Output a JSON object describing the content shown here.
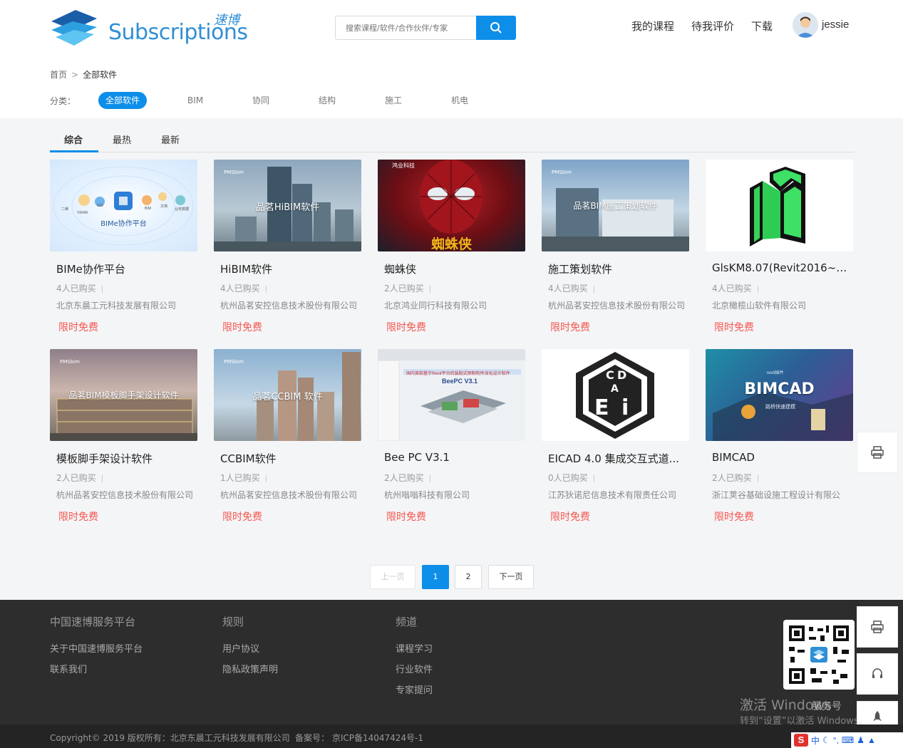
{
  "header": {
    "logo_text": "Subscriptions",
    "logo_cn": "速博",
    "search_placeholder": "搜索课程/软件/合作伙伴/专家",
    "nav": [
      "我的课程",
      "待我评价",
      "下载"
    ],
    "username": "jessie"
  },
  "breadcrumb": {
    "home": "首页",
    "sep": ">",
    "current": "全部软件"
  },
  "categories": {
    "label": "分类：",
    "items": [
      "全部软件",
      "BIM",
      "协同",
      "结构",
      "施工",
      "机电"
    ],
    "active_index": 0
  },
  "tabs": {
    "items": [
      "综合",
      "最热",
      "最新"
    ],
    "active_index": 0
  },
  "thumb_labels": {
    "pms": "PMSbim",
    "bime": "BIMe协作平台",
    "hibim": "品茗HiBIM软件",
    "spider": "蜘蛛侠",
    "spider_logo": "鸿业科技",
    "construction": "品茗BIM施工策划软件",
    "scaffold": "品茗BIM模板脚手架设计软件",
    "ccbim": "品茗CCBIM 软件",
    "beepc": "BeePC V3.1",
    "beepc_banner": "国内首款基于Revit平台的装配式预制构件深化设计软件",
    "bimcad": "BIMCAD",
    "bimcad_sub": "路桥快速建模",
    "bimcad_top": "revit插件",
    "bime_nodes": [
      "二维",
      "VR/AR",
      "GIS",
      "BIM",
      "文档",
      "业务数据"
    ]
  },
  "cards": [
    {
      "title": "BIMe协作平台",
      "buyers": "4人已购买",
      "company": "北京东晨工元科技发展有限公司",
      "price": "限时免费"
    },
    {
      "title": "HiBIM软件",
      "buyers": "4人已购买",
      "company": "杭州品茗安控信息技术股份有限公司",
      "price": "限时免费"
    },
    {
      "title": "蜘蛛侠",
      "buyers": "2人已购买",
      "company": "北京鸿业同行科技有限公司",
      "price": "限时免费"
    },
    {
      "title": "施工策划软件",
      "buyers": "4人已购买",
      "company": "杭州品茗安控信息技术股份有限公司",
      "price": "限时免费"
    },
    {
      "title": "GlsKM8.07(Revit2016~2...",
      "buyers": "4人已购买",
      "company": "北京橄榄山软件有限公司",
      "price": "限时免费"
    },
    {
      "title": "模板脚手架设计软件",
      "buyers": "2人已购买",
      "company": "杭州品茗安控信息技术股份有限公司",
      "price": "限时免费"
    },
    {
      "title": "CCBIM软件",
      "buyers": "1人已购买",
      "company": "杭州品茗安控信息技术股份有限公司",
      "price": "限时免费"
    },
    {
      "title": "Bee PC V3.1",
      "buyers": "2人已购买",
      "company": "杭州嗡嗡科技有限公司",
      "price": "限时免费"
    },
    {
      "title": "EICAD 4.0 集成交互式道...",
      "buyers": "0人已购买",
      "company": "江苏狄诺尼信息技术有限责任公司",
      "price": "限时免费"
    },
    {
      "title": "BIMCAD",
      "buyers": "2人已购买",
      "company": "浙江荚谷基础设施工程设计有限公",
      "price": "限时免费"
    }
  ],
  "pagination": {
    "prev": "上一页",
    "pages": [
      "1",
      "2"
    ],
    "active": "1",
    "next": "下一页"
  },
  "footer": {
    "cols": [
      {
        "head": "中国速博服务平台",
        "links": [
          "关于中国速博服务平台",
          "联系我们"
        ]
      },
      {
        "head": "规则",
        "links": [
          "用户协议",
          "隐私政策声明"
        ]
      },
      {
        "head": "频道",
        "links": [
          "课程学习",
          "行业软件",
          "专家提问"
        ]
      }
    ],
    "copyright": "Copyright© 2019 版权所有：北京东晨工元科技发展有限公司",
    "record": "备案号： 京ICP备14047424号-1"
  },
  "watermark": {
    "line1": "激活 Windows",
    "line1b": "服务号",
    "line2": "转到“设置”以激活 Windows。"
  },
  "ime": {
    "label": "中"
  },
  "colors": {
    "accent": "#0d8ee9",
    "free": "#f5564e",
    "footer_bg": "#2d2d2d"
  },
  "icons": [
    "search-icon",
    "printer-icon",
    "headset-icon",
    "rocket-icon"
  ]
}
